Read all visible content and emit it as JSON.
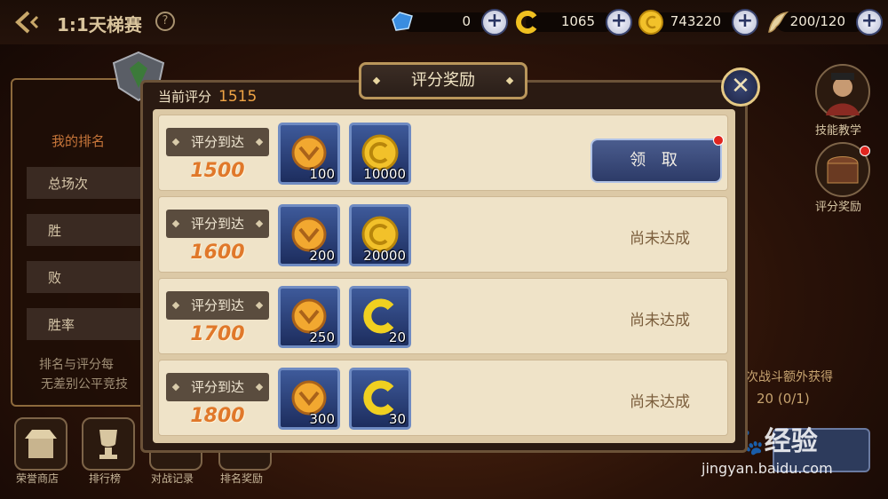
{
  "header": {
    "title": "1:1天梯赛",
    "help": "?"
  },
  "resources": [
    {
      "icon": "diamond-icon",
      "value": "0"
    },
    {
      "icon": "c-coin-icon",
      "value": "1065"
    },
    {
      "icon": "gold-coin-icon",
      "value": "743220"
    },
    {
      "icon": "wing-icon",
      "value": "200/120"
    }
  ],
  "left_panel": {
    "title": "我的排名",
    "rows": [
      "总场次",
      "胜",
      "败",
      "胜率"
    ],
    "note1": "排名与评分每",
    "note2": "无差别公平竞技"
  },
  "bottom_nav": [
    "荣誉商店",
    "排行榜",
    "对战记录",
    "排名奖励"
  ],
  "right_buttons": [
    "技能教学",
    "评分奖励"
  ],
  "extra": {
    "line1": "次战斗额外获得",
    "line2": "20 (0/1)"
  },
  "watermark": {
    "line1": "Bai🐾经验",
    "line2": "jingyan.baidu.com"
  },
  "modal": {
    "tab_title": "评分奖励",
    "current_label": "当前评分",
    "current_score": "1515",
    "close_label": "✕",
    "rows": [
      {
        "reach_label": "评分到达",
        "score": "1500",
        "rewards": [
          {
            "icon": "medal-icon",
            "count": "100"
          },
          {
            "icon": "gold-coin-icon",
            "count": "10000"
          }
        ],
        "status": "领 取",
        "claimable": true
      },
      {
        "reach_label": "评分到达",
        "score": "1600",
        "rewards": [
          {
            "icon": "medal-icon",
            "count": "200"
          },
          {
            "icon": "gold-coin-icon",
            "count": "20000"
          }
        ],
        "status": "尚未达成",
        "claimable": false
      },
      {
        "reach_label": "评分到达",
        "score": "1700",
        "rewards": [
          {
            "icon": "medal-icon",
            "count": "250"
          },
          {
            "icon": "c-coin-icon",
            "count": "20"
          }
        ],
        "status": "尚未达成",
        "claimable": false
      },
      {
        "reach_label": "评分到达",
        "score": "1800",
        "rewards": [
          {
            "icon": "medal-icon",
            "count": "300"
          },
          {
            "icon": "c-coin-icon",
            "count": "30"
          }
        ],
        "status": "尚未达成",
        "claimable": false
      }
    ]
  },
  "colors": {
    "accent_orange": "#e0782a",
    "claim_blue": "#3a4c80",
    "red_dot": "#e0251f"
  }
}
